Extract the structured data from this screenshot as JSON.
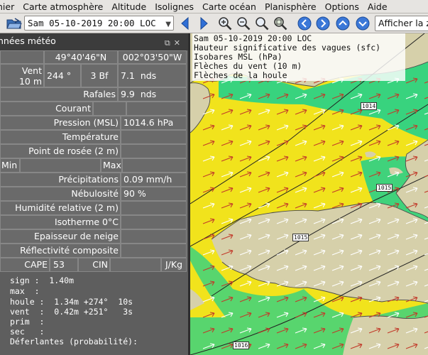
{
  "menu": [
    "hier",
    "Carte atmosphère",
    "Altitude",
    "Isolignes",
    "Carte océan",
    "Planisphère",
    "Options",
    "Aide"
  ],
  "toolbar": {
    "date_value": "Sam 05-10-2019 20:00 LOC",
    "search_placeholder": "Afficher la zone"
  },
  "panel": {
    "title": "nnées météo",
    "lat": "49°40'46\"N",
    "lon": "002°03'50\"W",
    "wind_label": "Vent\n10 m",
    "wind_dir": "244 °",
    "wind_bf": "3 Bf",
    "wind_speed": "7.1  nds",
    "gust_label": "Rafales",
    "gust_value": "9.9  nds",
    "current_label": "Courant",
    "pressure_label": "Pression (MSL)",
    "pressure_value": "1014.6 hPa",
    "temp_label": "Température",
    "dew_label": "Point de rosée (2 m)",
    "min_label": "Min",
    "max_label": "Max",
    "precip_label": "Précipitations",
    "precip_value": "0.09 mm/h",
    "cloud_label": "Nébulosité",
    "cloud_value": "90 %",
    "humidity_label": "Humidité relative (2 m)",
    "iso0_label": "Isotherme 0°C",
    "snow_label": "Epaisseur de neige",
    "refl_label": "Réflectivité composite",
    "cape_label": "CAPE",
    "cape_value": "53",
    "cin_label": "CIN",
    "jkg": "J/Kg",
    "waves": [
      "sign :  1.40m",
      "max  :",
      "houle :  1.34m +274°  10s",
      "vent  :  0.42m +251°   3s",
      "prim  :",
      "sec   :",
      "Déferlantes (probabilité):"
    ]
  },
  "map": {
    "header": [
      "Sam 05-10-2019 20:00 LOC",
      "Hauteur significative des vagues (sfc)",
      "Isobares MSL (hPa)",
      "Flèches du vent (10 m)",
      "Flèches de la houle"
    ],
    "isobars": [
      "1014",
      "1015",
      "1015",
      "1016"
    ]
  },
  "colors": {
    "sea_yellow": "#f1e31c",
    "sea_green": "#23d28a",
    "land": "#d7d1ab",
    "panel": "#5e5e5e"
  }
}
